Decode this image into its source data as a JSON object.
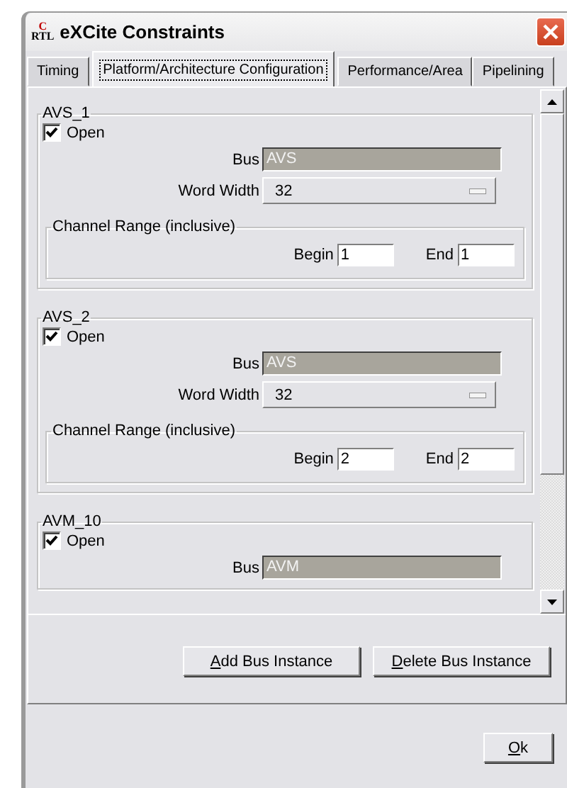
{
  "window": {
    "title": "eXCite Constraints",
    "logo": {
      "top": "C",
      "bottom": "RTL"
    }
  },
  "tabs": [
    {
      "label": "Timing",
      "selected": false
    },
    {
      "label": "Platform/Architecture Configuration",
      "selected": true
    },
    {
      "label": "Performance/Area",
      "selected": false
    },
    {
      "label": "Pipelining",
      "selected": false
    }
  ],
  "bus_instances": [
    {
      "name": "AVS_1",
      "open": {
        "label": "Open",
        "checked": true
      },
      "bus": {
        "label": "Bus",
        "value": "AVS",
        "disabled": true
      },
      "word_width": {
        "label": "Word Width",
        "value": "32"
      },
      "channel_range": {
        "title": "Channel Range (inclusive)",
        "begin": {
          "label": "Begin",
          "value": "1"
        },
        "end": {
          "label": "End",
          "value": "1"
        }
      }
    },
    {
      "name": "AVS_2",
      "open": {
        "label": "Open",
        "checked": true
      },
      "bus": {
        "label": "Bus",
        "value": "AVS",
        "disabled": true
      },
      "word_width": {
        "label": "Word Width",
        "value": "32"
      },
      "channel_range": {
        "title": "Channel Range (inclusive)",
        "begin": {
          "label": "Begin",
          "value": "2"
        },
        "end": {
          "label": "End",
          "value": "2"
        }
      }
    },
    {
      "name": "AVM_10",
      "open": {
        "label": "Open",
        "checked": true
      },
      "bus": {
        "label": "Bus",
        "value": "AVM",
        "disabled": true
      }
    }
  ],
  "buttons": [
    {
      "label": "Add Bus Instance"
    },
    {
      "label": "Delete Bus Instance"
    }
  ],
  "dialog_buttons": [
    {
      "label": "Ok"
    }
  ]
}
